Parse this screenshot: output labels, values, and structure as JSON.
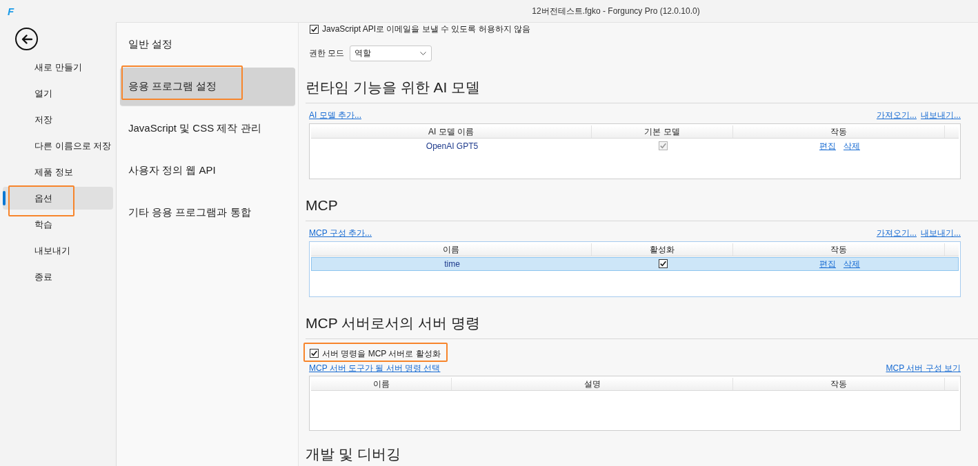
{
  "window": {
    "logo": "F",
    "title": "12버전테스트.fgko - Forguncy Pro (12.0.10.0)"
  },
  "sidebar": {
    "items": [
      {
        "label": "새로 만들기",
        "selected": false,
        "highlighted": false
      },
      {
        "label": "열기",
        "selected": false,
        "highlighted": false
      },
      {
        "label": "저장",
        "selected": false,
        "highlighted": false
      },
      {
        "label": "다른 이름으로 저장",
        "selected": false,
        "highlighted": false
      },
      {
        "label": "제품 정보",
        "selected": false,
        "highlighted": false
      },
      {
        "label": "옵션",
        "selected": true,
        "highlighted": true
      },
      {
        "label": "학습",
        "selected": false,
        "highlighted": false
      },
      {
        "label": "내보내기",
        "selected": false,
        "highlighted": false
      },
      {
        "label": "종료",
        "selected": false,
        "highlighted": false
      }
    ]
  },
  "options_nav": {
    "items": [
      {
        "label": "일반 설정",
        "selected": false,
        "highlighted": false
      },
      {
        "label": "응용 프로그램 설정",
        "selected": true,
        "highlighted": true
      },
      {
        "label": "JavaScript 및 CSS 제작 관리",
        "selected": false,
        "highlighted": false
      },
      {
        "label": "사용자 정의 웹 API",
        "selected": false,
        "highlighted": false
      },
      {
        "label": "기타 응용 프로그램과 통합",
        "selected": false,
        "highlighted": false
      }
    ]
  },
  "settings": {
    "email_option": {
      "label": "JavaScript API로 이메일을 보낼 수 있도록 허용하지 않음",
      "checked": true
    },
    "permission_mode": {
      "label": "권한 모드",
      "value": "역할"
    },
    "sections": [
      {
        "kind": "table",
        "heading": "런타임 기능을 위한 AI 모델",
        "left_link": "AI 모델 추가...",
        "right_links": [
          "가져오기...",
          "내보내기..."
        ],
        "focused": false,
        "columns": [
          "AI 모델 이름",
          "기본 모델",
          "작동"
        ],
        "rows": [
          {
            "name": "OpenAI GPT5",
            "checked": true,
            "disabled": true,
            "actions": [
              "편집",
              "삭제"
            ],
            "selected": false
          }
        ]
      },
      {
        "kind": "table",
        "heading": "MCP",
        "left_link": "MCP 구성 추가...",
        "right_links": [
          "가져오기...",
          "내보내기..."
        ],
        "focused": true,
        "columns": [
          "이름",
          "활성화",
          "작동"
        ],
        "rows": [
          {
            "name": "time",
            "checked": true,
            "disabled": false,
            "actions": [
              "편집",
              "삭제"
            ],
            "selected": true
          }
        ]
      },
      {
        "kind": "table",
        "heading": "MCP 서버로서의 서버 명령",
        "checkbox": {
          "label": "서버 명령을 MCP 서버로 활성화",
          "checked": true,
          "highlighted": true
        },
        "left_link": "MCP 서버 도구가 될 서버 명령 선택",
        "right_links": [
          "MCP 서버 구성 보기"
        ],
        "focused": false,
        "columns": [
          "이름",
          "설명",
          "작동"
        ]
      },
      {
        "kind": "heading",
        "heading": "개발 및 디버깅"
      }
    ]
  }
}
